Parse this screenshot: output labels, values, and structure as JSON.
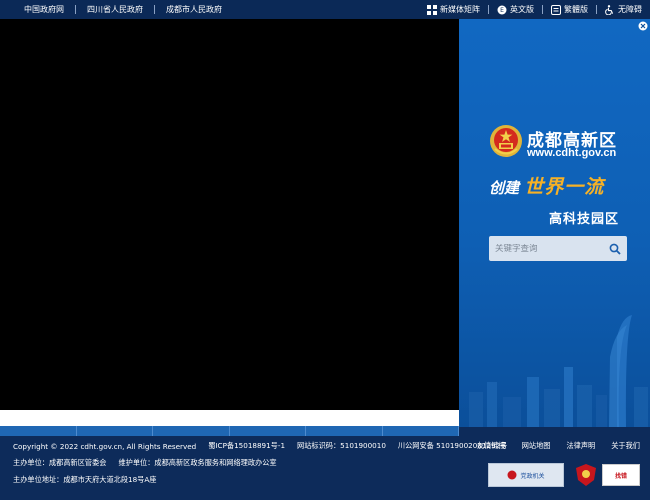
{
  "topbar": {
    "links": [
      "中国政府网",
      "四川省人民政府",
      "成都市人民政府"
    ],
    "tools": [
      {
        "label": "新媒体矩阵",
        "icon": "grid-icon"
      },
      {
        "label": "英文版",
        "icon": "translate-icon"
      },
      {
        "label": "繁體版",
        "icon": "traditional-chinese-icon"
      },
      {
        "label": "无障碍",
        "icon": "accessibility-icon"
      }
    ]
  },
  "panel": {
    "brand_name": "成都高新区",
    "brand_url": "www.cdht.gov.cn",
    "slogan_prefix": "创建",
    "slogan_accent": "世界一流",
    "slogan_line2": "高科技园区",
    "search_placeholder": "关键字查询"
  },
  "footer": {
    "copyright": "Copyright © 2022 cdht.gov.cn, All Rights Reserved",
    "icp": "蜀ICP备15018891号-1",
    "site_code": "网站标识码：5101900010",
    "police": "川公网安备 51019002001292号",
    "sponsor": "主办单位：成都高新区管委会",
    "maintainer": "维护单位：成都高新区政务服务和网络理政办公室",
    "address": "主办单位地址：成都市天府大道北段18号A座",
    "links": [
      "友情链接",
      "网站地图",
      "法律声明",
      "关于我们"
    ],
    "badge1_text": "党政机关",
    "badge3_text": "找错"
  },
  "colors": {
    "topbar": "#0b2957",
    "panel": "#1168c2",
    "footer": "#0d2b5a",
    "accent": "#f6b126"
  }
}
